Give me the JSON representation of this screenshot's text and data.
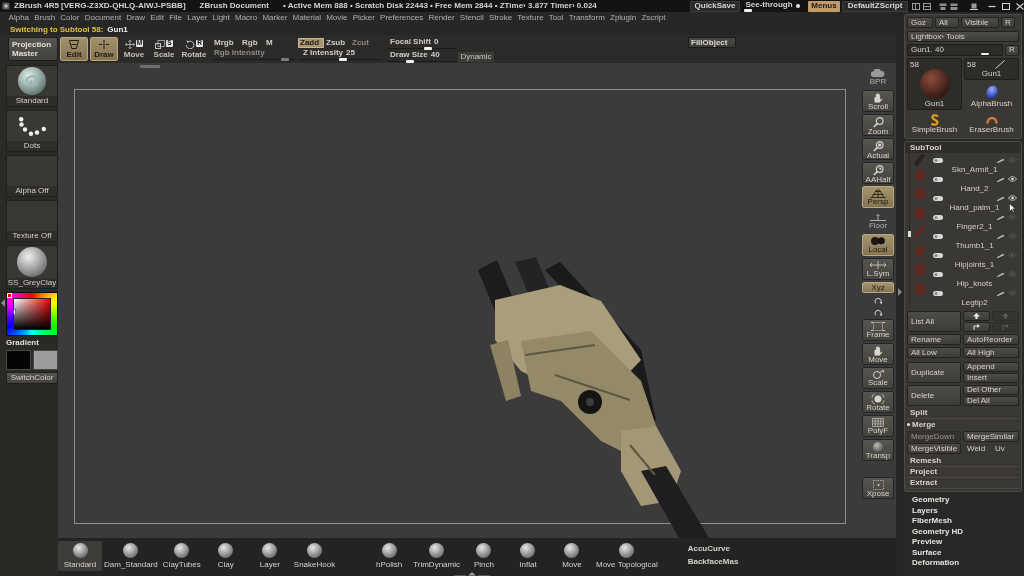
{
  "title_bar": {
    "app_title": "ZBrush 4R5 [VERG-Z3XD-QHLQ-AIWJ-PSBB]",
    "document": "ZBrush Document",
    "stats": "• Active Mem 888 • Scratch Disk 22443 • Free Mem 2844 • ZTime› 3.877 Timer› 0.024",
    "quicksave": "QuickSave",
    "see_through": {
      "label": "See-through",
      "level": 0
    },
    "menus": {
      "label": "Menus",
      "on": true
    },
    "script": "DefaultZScript"
  },
  "menu_bar": [
    "Alpha",
    "Brush",
    "Color",
    "Document",
    "Draw",
    "Edit",
    "File",
    "Layer",
    "Light",
    "Macro",
    "Marker",
    "Material",
    "Movie",
    "Picker",
    "Preferences",
    "Render",
    "Stencil",
    "Stroke",
    "Texture",
    "Tool",
    "Transform",
    "Zplugin",
    "Zscript"
  ],
  "notification": {
    "message": "Switching to Subtool 58:",
    "subtool": "Gun1"
  },
  "top_shelf": {
    "projection_master": "Projection Master",
    "modes": [
      {
        "kind": "edit",
        "label": "Edit",
        "selected": true
      },
      {
        "kind": "draw",
        "label": "Draw",
        "selected": true
      },
      {
        "kind": "move",
        "label": "Move",
        "badge": "M",
        "selected": false
      },
      {
        "kind": "scale",
        "label": "Scale",
        "badge": "S",
        "selected": false
      },
      {
        "kind": "rotate",
        "label": "Rotate",
        "badge": "R",
        "selected": false
      }
    ],
    "color_modes": [
      {
        "label": "Mrgb",
        "selected": false
      },
      {
        "label": "Rgb",
        "selected": false
      },
      {
        "label": "M",
        "selected": false
      }
    ],
    "rgb_intensity": {
      "label": "Rgb Intensity",
      "disabled": true,
      "level": 0.93
    },
    "depth_modes": [
      {
        "label": "Zadd",
        "selected": true,
        "disabled": false
      },
      {
        "label": "Zsub",
        "selected": false,
        "disabled": false
      },
      {
        "label": "Zcut",
        "selected": false,
        "disabled": true
      }
    ],
    "z_intensity": {
      "label": "Z Intensity",
      "value": "25",
      "level": 0.54
    },
    "focal_shift": {
      "label": "Focal Shift",
      "value": "0",
      "level": 0.6
    },
    "draw_size": {
      "label": "Draw Size",
      "value": "40",
      "level": 0.3
    },
    "dynamic": "Dynamic",
    "fill_object": "FillObject"
  },
  "left_shelf": {
    "brush": "Standard",
    "stroke": "Dots",
    "alpha": "Alpha Off",
    "texture": "Texture Off",
    "material": "SS_GreyClay",
    "gradient": "Gradient",
    "swatches": [
      {
        "color": "#050505"
      },
      {
        "color": "#9c9c9c"
      }
    ],
    "switch_color": "SwitchColor"
  },
  "view_controls": [
    {
      "kind": "render",
      "label": "BPR",
      "on": false
    },
    {
      "kind": "scroll",
      "label": "Scroll",
      "on": false
    },
    {
      "kind": "zoom",
      "label": "Zoom",
      "on": false
    },
    {
      "kind": "actual",
      "label": "Actual",
      "on": false
    },
    {
      "kind": "aahalf",
      "label": "AAHalf",
      "on": false
    },
    {
      "kind": "persp",
      "label": "Persp",
      "on": true
    },
    {
      "kind": "floor",
      "label": "Floor",
      "on": false
    },
    {
      "kind": "local",
      "label": "Local",
      "on": true
    },
    {
      "kind": "lsym",
      "label": "L.Sym",
      "on": false
    },
    {
      "kind": "axes",
      "label": "Xyz",
      "on": true
    },
    {
      "kind": "spin",
      "on": false
    },
    {
      "kind": "spin",
      "on": false
    },
    {
      "kind": "frame",
      "label": "Frame",
      "on": false
    },
    {
      "kind": "move",
      "label": "Move",
      "on": false
    },
    {
      "kind": "scale",
      "label": "Scale",
      "on": false
    },
    {
      "kind": "rotate",
      "label": "Rotate",
      "on": false
    },
    {
      "kind": "polyf",
      "label": "PolyF",
      "on": false
    },
    {
      "kind": "transp",
      "label": "Transp",
      "on": false
    },
    {
      "kind": "xpose",
      "label": "Xpose",
      "on": false
    }
  ],
  "tool_palette": {
    "buttons": [
      "Goz",
      "All",
      "Visible",
      "R"
    ],
    "lightbox": "Lightbox› Tools",
    "tool_slider": {
      "label": "Gun1. 40",
      "level": 0.85,
      "reset": "R"
    },
    "tools": [
      {
        "kind": "model",
        "count": "58",
        "name": "Gun1"
      },
      {
        "kind": "model_line",
        "count": "58",
        "name": "Gun1"
      },
      {
        "kind": "alpha",
        "name": "AlphaBrush"
      },
      {
        "kind": "simple",
        "name": "SimpleBrush"
      },
      {
        "kind": "eraser",
        "name": "EraserBrush"
      }
    ]
  },
  "subtool": {
    "title": "SubTool",
    "items": [
      {
        "kind": "toggles_only",
        "eye": false
      },
      {
        "kind": "full",
        "name": "Skn_Armit_1",
        "eye": true
      },
      {
        "kind": "full",
        "name": "Hand_2",
        "eye": true
      },
      {
        "kind": "full",
        "name": "Hand_palm_1",
        "eye": false
      },
      {
        "kind": "full",
        "name": "Finger2_1",
        "eye": false
      },
      {
        "kind": "full",
        "name": "Thumb1_1",
        "eye": false
      },
      {
        "kind": "full",
        "name": "Hipjoints_1",
        "eye": false
      },
      {
        "kind": "full",
        "name": "Hip_knots",
        "eye": false
      },
      {
        "kind": "name_only",
        "name": "Legtip2"
      }
    ],
    "list_all": "List All",
    "arrow_buttons": [
      {
        "kind": "up",
        "disabled": false
      },
      {
        "kind": "up",
        "disabled": true
      },
      {
        "kind": "down",
        "disabled": false
      },
      {
        "kind": "down",
        "disabled": true
      }
    ],
    "pairs": [
      [
        "Rename",
        "AutoReorder"
      ],
      [
        "All Low",
        "All High"
      ]
    ],
    "duplicate": "Duplicate",
    "append": "Append",
    "insert": "Insert",
    "delete": "Delete",
    "del_other": "Del Other",
    "del_all": "Del All",
    "split": "Split",
    "merge": {
      "label": "Merge",
      "expanded": true,
      "merge_down": {
        "label": "MergeDown",
        "disabled": true
      },
      "merge_similar": {
        "label": "MergeSimilar",
        "disabled": false
      },
      "merge_visible": {
        "label": "MergeVisible",
        "disabled": false
      },
      "weld": {
        "label": "Weld",
        "on": false
      },
      "uv": {
        "label": "Uv",
        "on": false
      }
    },
    "sub_palettes": [
      "Remesh",
      "Project",
      "Extract"
    ]
  },
  "palettes": [
    "Geometry",
    "Layers",
    "FiberMesh",
    "Geometry HD",
    "Preview",
    "Surface",
    "Deformation"
  ],
  "brush_shelf": {
    "groups": [
      [
        {
          "name": "Standard",
          "selected": true
        },
        {
          "name": "Dam_Standard",
          "selected": false
        },
        {
          "name": "ClayTubes",
          "selected": false
        },
        {
          "name": "Clay",
          "selected": false
        },
        {
          "name": "Layer",
          "selected": false
        },
        {
          "name": "SnakeHook",
          "selected": false
        }
      ],
      [
        {
          "name": "hPolish",
          "selected": false
        },
        {
          "name": "TrimDynamic",
          "selected": false
        },
        {
          "name": "Pinch",
          "selected": false
        },
        {
          "name": "Inflat",
          "selected": false
        },
        {
          "name": "Move",
          "selected": false
        },
        {
          "name": "Move Topological",
          "selected": false
        }
      ]
    ],
    "options": [
      "AccuCurve",
      "BackfaceMas"
    ]
  }
}
